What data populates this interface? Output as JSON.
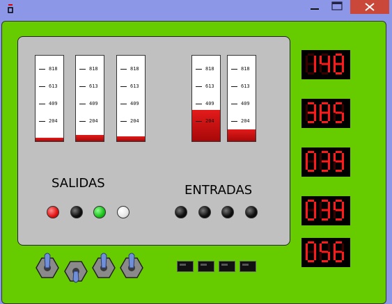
{
  "title_bar": {
    "icons": [
      "app-icon",
      "minimize-icon",
      "maximize-icon",
      "close-icon"
    ]
  },
  "outputs": {
    "label": "SALIDAS",
    "gauges": [
      {
        "level_percent": 4
      },
      {
        "level_percent": 7
      },
      {
        "level_percent": 6
      }
    ],
    "leds": [
      {
        "state": "red",
        "color": "#e01010"
      },
      {
        "state": "off",
        "color": "#111111"
      },
      {
        "state": "green",
        "color": "#18c018"
      },
      {
        "state": "white",
        "color": "#e6e6e6"
      }
    ]
  },
  "inputs": {
    "label": "ENTRADAS",
    "gauges": [
      {
        "level_percent": 37
      },
      {
        "level_percent": 14
      }
    ],
    "leds": [
      {
        "state": "off",
        "color": "#111111"
      },
      {
        "state": "off",
        "color": "#111111"
      },
      {
        "state": "off",
        "color": "#111111"
      },
      {
        "state": "off",
        "color": "#111111"
      }
    ]
  },
  "gauge_ticks": [
    "818",
    "613",
    "409",
    "204"
  ],
  "displays": [
    "148",
    "385",
    "039",
    "039",
    "056"
  ],
  "switches": [
    {
      "position": "up"
    },
    {
      "position": "down"
    },
    {
      "position": "up"
    },
    {
      "position": "up"
    }
  ],
  "pads": 4,
  "colors": {
    "window": "#66cc00",
    "panel": "#c0c0c0",
    "titlebar": "#8c97e8",
    "segment_on": "#ff1a1a",
    "segment_off": "#3a0000",
    "gauge_fill": "#e31b1b",
    "switch_blue": "#6f8fd8"
  }
}
